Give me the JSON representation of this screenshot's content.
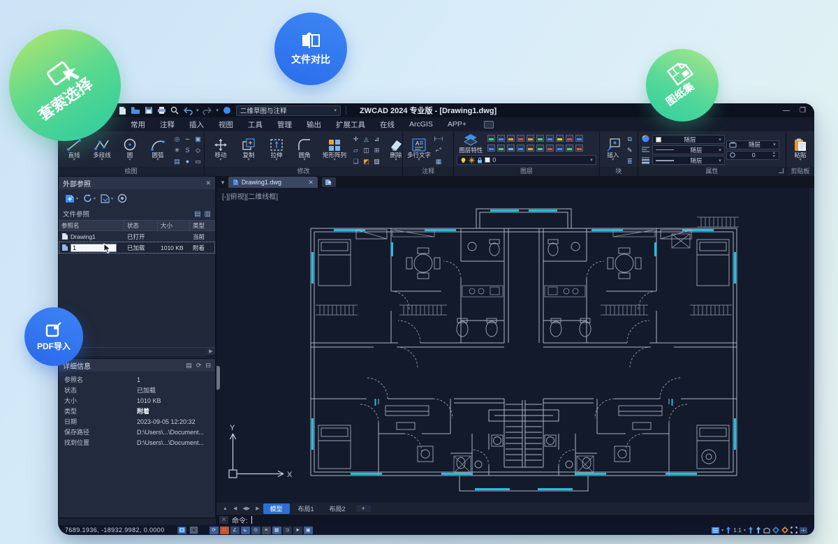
{
  "badges": {
    "lasso": {
      "label": "套索选择"
    },
    "compare": {
      "label": "文件对比"
    },
    "sheetset": {
      "label": "图纸集"
    },
    "pdf": {
      "label": "PDF导入"
    }
  },
  "titlebar": {
    "workspace": "二维草图与注释",
    "title": "ZWCAD 2024 专业版 - [Drawing1.dwg]",
    "minimize": "—",
    "maximize": "❐"
  },
  "ribbon": {
    "tabs": [
      "常用",
      "注释",
      "插入",
      "视图",
      "工具",
      "管理",
      "输出",
      "扩展工具",
      "在线",
      "ArcGIS",
      "APP+"
    ],
    "panels": {
      "draw": {
        "label": "绘图",
        "buttons": [
          "直线",
          "多段线",
          "圆",
          "圆弧"
        ]
      },
      "modify": {
        "label": "修改",
        "buttons": [
          "移动",
          "复制",
          "拉伸",
          "圆角",
          "矩形阵列",
          "删除"
        ]
      },
      "annotate": {
        "label": "注释",
        "buttons": [
          "多行文字"
        ]
      },
      "layers": {
        "label": "图层",
        "buttons": [
          "图层特性"
        ],
        "layer_value": "0"
      },
      "block": {
        "label": "块",
        "buttons": [
          "插入"
        ]
      },
      "properties": {
        "label": "属性",
        "values": [
          "随层",
          "随层",
          "随层"
        ],
        "right_value": "随层",
        "spin": "0"
      },
      "clipboard": {
        "label": "剪贴板",
        "buttons": [
          "粘贴"
        ]
      }
    }
  },
  "xref_palette": {
    "title": "外部参照",
    "section": "文件参照",
    "columns": [
      "参照名",
      "状态",
      "大小",
      "类型"
    ],
    "rows": [
      {
        "name": "Drawing1",
        "status": "已打开",
        "size": "",
        "type": "当前"
      },
      {
        "name": "1",
        "status": "已加载",
        "size": "1010 KB",
        "type": "附着"
      }
    ]
  },
  "details_palette": {
    "title": "详细信息",
    "fields": [
      {
        "label": "参照名",
        "value": "1"
      },
      {
        "label": "状态",
        "value": "已加载"
      },
      {
        "label": "大小",
        "value": "1010 KB"
      },
      {
        "label": "类型",
        "value": "附着"
      },
      {
        "label": "日期",
        "value": "2023-09-05 12:20:32"
      },
      {
        "label": "保存路径",
        "value": "D:\\Users\\...\\Document..."
      },
      {
        "label": "找到位置",
        "value": "D:\\Users\\...\\Document..."
      }
    ]
  },
  "drawing": {
    "doc_tab": "Drawing1.dwg",
    "viewport_label": "[-][俯视][二维线框]",
    "layout_tabs": [
      "模型",
      "布局1",
      "布局2"
    ],
    "command_prompt": "命令:"
  },
  "statusbar": {
    "coords": "7689.1936, -18932.9982, 0.0000",
    "scale": "1:1"
  }
}
